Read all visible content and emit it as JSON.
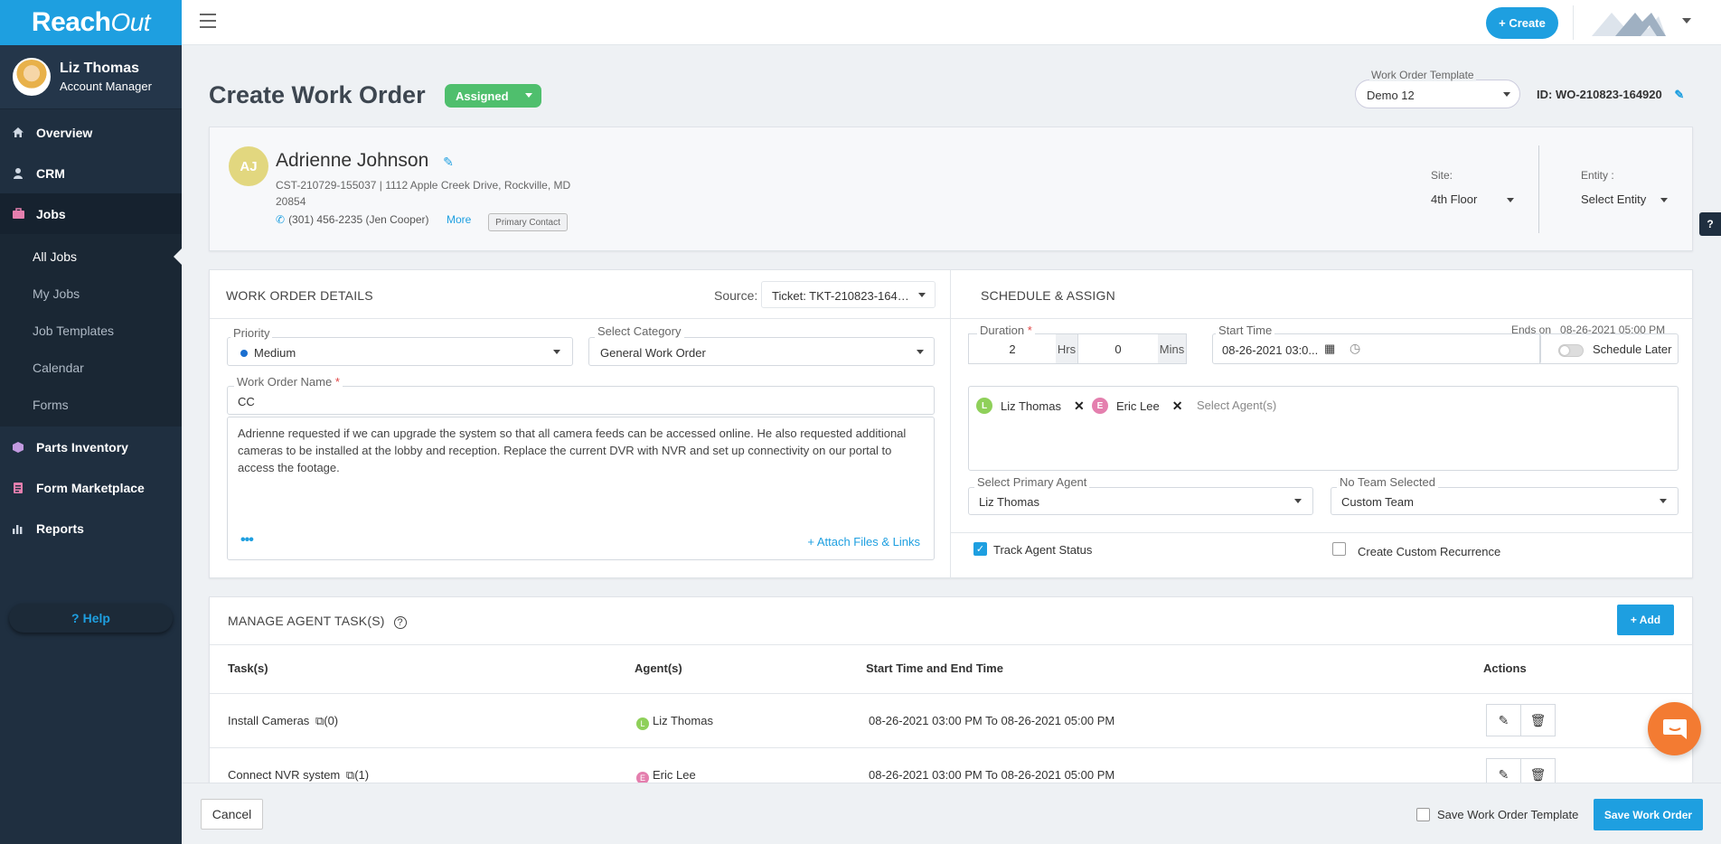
{
  "brand": {
    "name_part1": "Reach",
    "name_part2": "Out"
  },
  "user": {
    "name": "Liz Thomas",
    "role": "Account Manager"
  },
  "sidebar": {
    "items": [
      {
        "label": "Overview",
        "icon": "home-icon"
      },
      {
        "label": "CRM",
        "icon": "person-icon"
      },
      {
        "label": "Jobs",
        "icon": "briefcase-icon"
      },
      {
        "label": "Parts Inventory",
        "icon": "box-icon"
      },
      {
        "label": "Form Marketplace",
        "icon": "form-icon"
      },
      {
        "label": "Reports",
        "icon": "bar-chart-icon"
      }
    ],
    "jobs_sub": [
      "All Jobs",
      "My Jobs",
      "Job Templates",
      "Calendar",
      "Forms"
    ],
    "help_label": "Help"
  },
  "topbar": {
    "create_label": "+ Create"
  },
  "header": {
    "title": "Create Work Order",
    "status": "Assigned",
    "template_label": "Work Order Template",
    "template_value": "Demo 12",
    "wo_id": "ID: WO-210823-164920"
  },
  "customer": {
    "initials": "AJ",
    "name": "Adrienne Johnson",
    "address": "CST-210729-155037 | 1112 Apple Creek Drive, Rockville, MD 20854",
    "phone": "(301) 456-2235 (Jen Cooper)",
    "more_label": "More",
    "primary_badge": "Primary Contact",
    "site_label": "Site:",
    "site_value": "4th Floor",
    "entity_label": "Entity :",
    "entity_value": "Select Entity"
  },
  "details": {
    "title": "WORK ORDER DETAILS",
    "source_label": "Source:",
    "source_value": "Ticket: TKT-210823-164…",
    "priority_label": "Priority",
    "priority_value": "Medium",
    "category_label": "Select Category",
    "category_value": "General Work Order",
    "name_label": "Work Order Name",
    "name_value": "CC",
    "description": "Adrienne requested if we can upgrade the system so that all camera feeds can be accessed online. He also requested additional cameras to be installed at the lobby and reception. Replace the current DVR with NVR and set up connectivity on our portal to access the footage.",
    "more_dots": "•••",
    "attach_label": "+ Attach Files & Links"
  },
  "schedule": {
    "title": "SCHEDULE & ASSIGN",
    "duration_label": "Duration",
    "hours": "2",
    "hrs_unit": "Hrs",
    "mins": "0",
    "mins_unit": "Mins",
    "start_label": "Start Time",
    "start_value": "08-26-2021 03:0...",
    "ends_on_label": "Ends on",
    "ends_on_value": "08-26-2021 05:00 PM",
    "schedule_later": "Schedule Later",
    "agents": [
      {
        "initial": "L",
        "name": "Liz Thomas",
        "color": "#8fd05a"
      },
      {
        "initial": "E",
        "name": "Eric Lee",
        "color": "#e47fae"
      }
    ],
    "agents_placeholder": "Select Agent(s)",
    "primary_agent_label": "Select Primary Agent",
    "primary_agent_value": "Liz Thomas",
    "team_label": "No Team Selected",
    "team_value": "Custom Team",
    "track_status": "Track Agent Status",
    "track_checked": true,
    "recurrence": "Create Custom Recurrence",
    "recurrence_checked": false
  },
  "tasks": {
    "title": "MANAGE AGENT TASK(S)",
    "add_label": "+ Add",
    "columns": [
      "Task(s)",
      "Agent(s)",
      "Start Time and End Time",
      "Actions"
    ],
    "rows": [
      {
        "task": "Install Cameras",
        "count": "(0)",
        "agent_initial": "L",
        "agent": "Liz Thomas",
        "agent_color": "#8fd05a",
        "time": "08-26-2021 03:00 PM To 08-26-2021 05:00 PM"
      },
      {
        "task": "Connect NVR system",
        "count": "(1)",
        "agent_initial": "E",
        "agent": "Eric Lee",
        "agent_color": "#e47fae",
        "time": "08-26-2021 03:00 PM To 08-26-2021 05:00 PM"
      }
    ]
  },
  "footer": {
    "cancel_label": "Cancel",
    "save_template_label": "Save Work Order Template",
    "save_label": "Save Work Order"
  },
  "colors": {
    "accent": "#1e9fe0",
    "sidebar": "#1f2f40",
    "status_green": "#4fbf6d",
    "chat": "#f37b32"
  }
}
